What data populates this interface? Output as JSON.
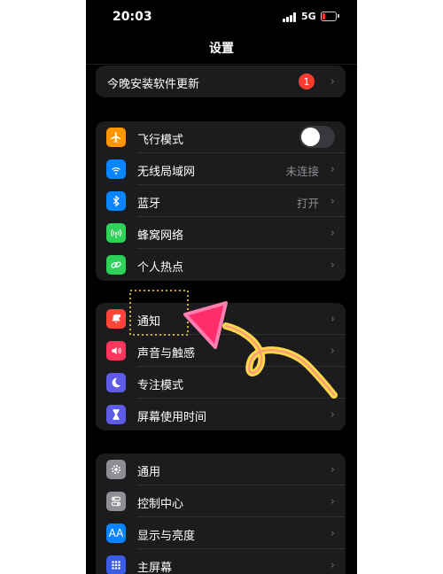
{
  "status_bar": {
    "time": "20:03",
    "network": "5G",
    "battery_level": 0.2
  },
  "nav": {
    "title": "设置"
  },
  "update": {
    "label": "今晚安装软件更新",
    "badge": "1"
  },
  "group1": {
    "airplane": {
      "label": "飞行模式",
      "on": false
    },
    "wifi": {
      "label": "无线局域网",
      "value": "未连接"
    },
    "bluetooth": {
      "label": "蓝牙",
      "value": "打开"
    },
    "cellular": {
      "label": "蜂窝网络"
    },
    "hotspot": {
      "label": "个人热点"
    }
  },
  "group2": {
    "notifications": {
      "label": "通知"
    },
    "sounds": {
      "label": "声音与触感"
    },
    "focus": {
      "label": "专注模式"
    },
    "screen_time": {
      "label": "屏幕使用时间"
    }
  },
  "group3": {
    "general": {
      "label": "通用"
    },
    "control_center": {
      "label": "控制中心"
    },
    "display": {
      "label": "显示与亮度",
      "icon_text": "AA"
    },
    "home_screen": {
      "label": "主屏幕"
    }
  },
  "chevron": "›",
  "colors": {
    "airplane": "#ff9500",
    "wifi": "#0a84ff",
    "bluetooth": "#0a84ff",
    "cellular": "#30d158",
    "hotspot": "#30d158",
    "notifications": "#ff453a",
    "sounds": "#ff375f",
    "focus": "#5e5ce6",
    "screen_time": "#5e5ce6",
    "general": "#8e8e93",
    "control_center": "#8e8e93",
    "display": "#0a84ff",
    "home_screen": "#3a5ce6",
    "annotation_pink": "#ff2d6a",
    "annotation_yellow": "#ffd84a"
  }
}
